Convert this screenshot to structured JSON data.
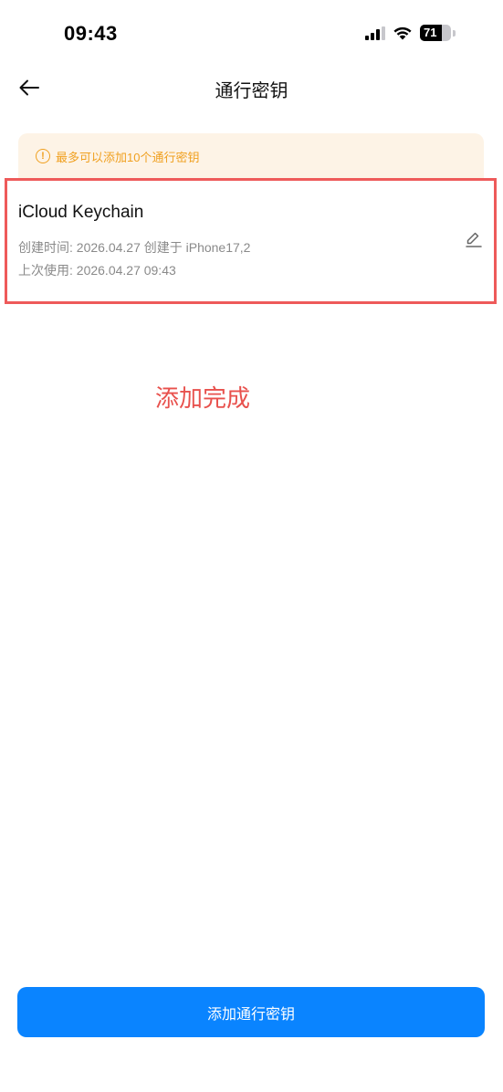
{
  "status_bar": {
    "time": "09:43",
    "battery_level": "71",
    "battery_fraction": 0.71,
    "icons": [
      "signal-icon",
      "wifi-icon",
      "battery-icon"
    ]
  },
  "header": {
    "title": "通行密钥",
    "back_icon": "arrow-left-icon"
  },
  "notice": {
    "icon": "info-circle-icon",
    "icon_glyph": "!",
    "text": "最多可以添加10个通行密钥",
    "color": "#f0a020",
    "background": "#fdf3e6"
  },
  "passkeys": [
    {
      "name": "iCloud Keychain",
      "created_label": "创建时间:",
      "created_value": "2026.04.27 创建于 iPhone17,2",
      "last_used_label": "上次使用:",
      "last_used_value": "2026.04.27 09:43",
      "edit_icon": "pencil-icon"
    }
  ],
  "annotation": {
    "text": "添加完成",
    "color": "#e8514d",
    "highlight_color": "#ee5a5a"
  },
  "footer": {
    "add_button_label": "添加通行密钥",
    "accent": "#0a84ff"
  }
}
